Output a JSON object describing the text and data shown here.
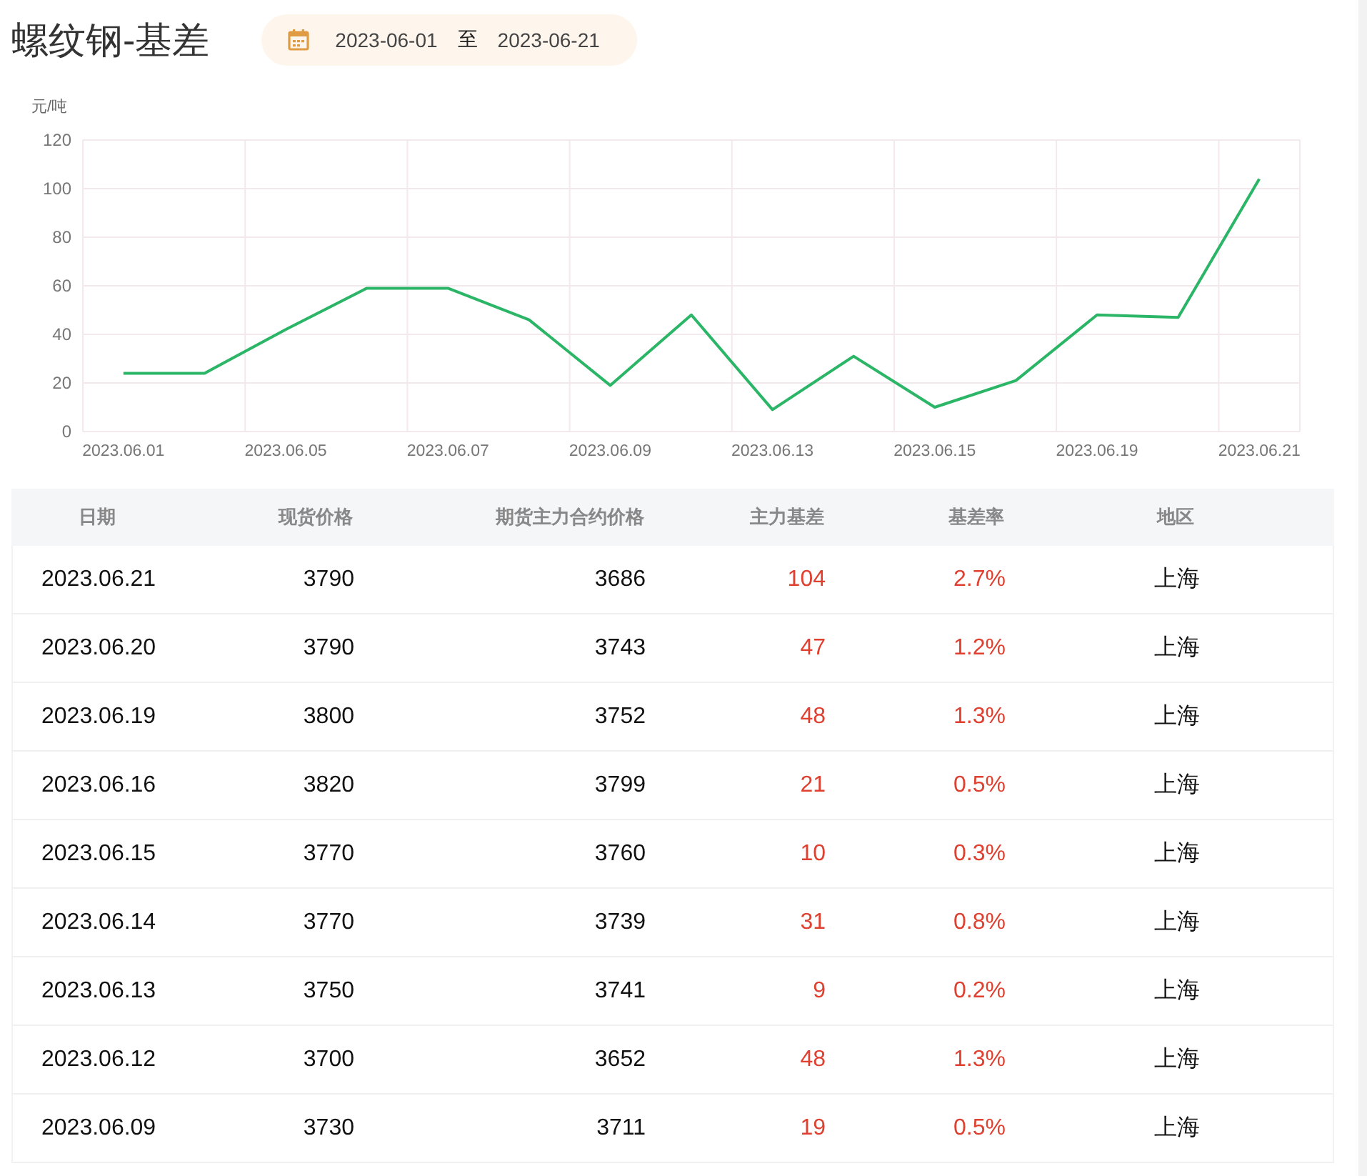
{
  "header": {
    "title": "螺纹钢-基差",
    "date_range": {
      "start": "2023-06-01",
      "separator": "至",
      "end": "2023-06-21"
    }
  },
  "chart": {
    "chart_data": {
      "type": "line",
      "ylabel": "元/吨",
      "categories": [
        "2023.06.01",
        null,
        "2023.06.05",
        null,
        "2023.06.07",
        null,
        "2023.06.09",
        null,
        "2023.06.13",
        null,
        "2023.06.15",
        null,
        "2023.06.19",
        null,
        "2023.06.21"
      ],
      "series": [
        {
          "color": "#2bb566",
          "values": [
            24,
            24,
            42,
            59,
            59,
            46,
            19,
            48,
            9,
            31,
            10,
            21,
            48,
            47,
            104
          ]
        }
      ],
      "ylim": [
        0,
        120
      ],
      "yticks": [
        0,
        20,
        40,
        60,
        80,
        100,
        120
      ],
      "grid": true
    }
  },
  "table": {
    "columns": [
      "日期",
      "现货价格",
      "期货主力合约价格",
      "主力基差",
      "基差率",
      "地区"
    ],
    "rows": [
      {
        "date": "2023.06.21",
        "spot": "3790",
        "futures": "3686",
        "basis": "104",
        "rate": "2.7%",
        "region": "上海"
      },
      {
        "date": "2023.06.20",
        "spot": "3790",
        "futures": "3743",
        "basis": "47",
        "rate": "1.2%",
        "region": "上海"
      },
      {
        "date": "2023.06.19",
        "spot": "3800",
        "futures": "3752",
        "basis": "48",
        "rate": "1.3%",
        "region": "上海"
      },
      {
        "date": "2023.06.16",
        "spot": "3820",
        "futures": "3799",
        "basis": "21",
        "rate": "0.5%",
        "region": "上海"
      },
      {
        "date": "2023.06.15",
        "spot": "3770",
        "futures": "3760",
        "basis": "10",
        "rate": "0.3%",
        "region": "上海"
      },
      {
        "date": "2023.06.14",
        "spot": "3770",
        "futures": "3739",
        "basis": "31",
        "rate": "0.8%",
        "region": "上海"
      },
      {
        "date": "2023.06.13",
        "spot": "3750",
        "futures": "3741",
        "basis": "9",
        "rate": "0.2%",
        "region": "上海"
      },
      {
        "date": "2023.06.12",
        "spot": "3700",
        "futures": "3652",
        "basis": "48",
        "rate": "1.3%",
        "region": "上海"
      },
      {
        "date": "2023.06.09",
        "spot": "3730",
        "futures": "3711",
        "basis": "19",
        "rate": "0.5%",
        "region": "上海"
      }
    ]
  }
}
